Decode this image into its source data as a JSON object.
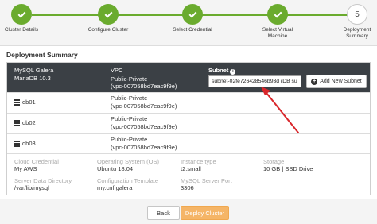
{
  "stepper": {
    "steps": [
      {
        "label": "Cluster Details",
        "state": "done"
      },
      {
        "label": "Configure Cluster",
        "state": "done"
      },
      {
        "label": "Select Credential",
        "state": "done"
      },
      {
        "label": "Select Virtual Machine",
        "state": "done"
      },
      {
        "label": "Deployment Summary",
        "state": "current",
        "number": "5"
      }
    ]
  },
  "summary": {
    "title": "Deployment Summary",
    "header": {
      "db_type": "MySQL Galera",
      "db_version": "MariaDB 10.3",
      "vpc_title": "VPC",
      "vpc_type": "Public-Private",
      "vpc_id": "(vpc-007058bd7eac9f9e)",
      "subnet_title": "Subnet",
      "subnet_value": "subnet-02fe726428546b93d (DB su",
      "add_subnet_label": "Add New Subnet"
    },
    "nodes": [
      {
        "name": "db01",
        "vpc_type": "Public-Private",
        "vpc_id": "(vpc-007058bd7eac9f9e)"
      },
      {
        "name": "db02",
        "vpc_type": "Public-Private",
        "vpc_id": "(vpc-007058bd7eac9f9e)"
      },
      {
        "name": "db03",
        "vpc_type": "Public-Private",
        "vpc_id": "(vpc-007058bd7eac9f9e)"
      }
    ],
    "details": {
      "cloud_credential": {
        "label": "Cloud Credential",
        "value": "My AWS"
      },
      "operating_system": {
        "label": "Operating System (OS)",
        "value": "Ubuntu 18.04"
      },
      "instance_type": {
        "label": "Instance type",
        "value": "t2.small"
      },
      "storage": {
        "label": "Storage",
        "value": "10 GB | SSD Drive"
      },
      "server_data_directory": {
        "label": "Server Data Directory",
        "value": "/var/lib/mysql"
      },
      "configuration_template": {
        "label": "Configuration Template",
        "value": "my.cnf.galera"
      },
      "mysql_server_port": {
        "label": "MySQL Server Port",
        "value": "3306"
      }
    }
  },
  "footer": {
    "back_label": "Back",
    "deploy_label": "Deploy Cluster"
  },
  "colors": {
    "step_done": "#6aab2e",
    "header_bg": "#3b4045",
    "deploy_button": "#f5b567",
    "annotation_arrow": "#d9262b"
  }
}
